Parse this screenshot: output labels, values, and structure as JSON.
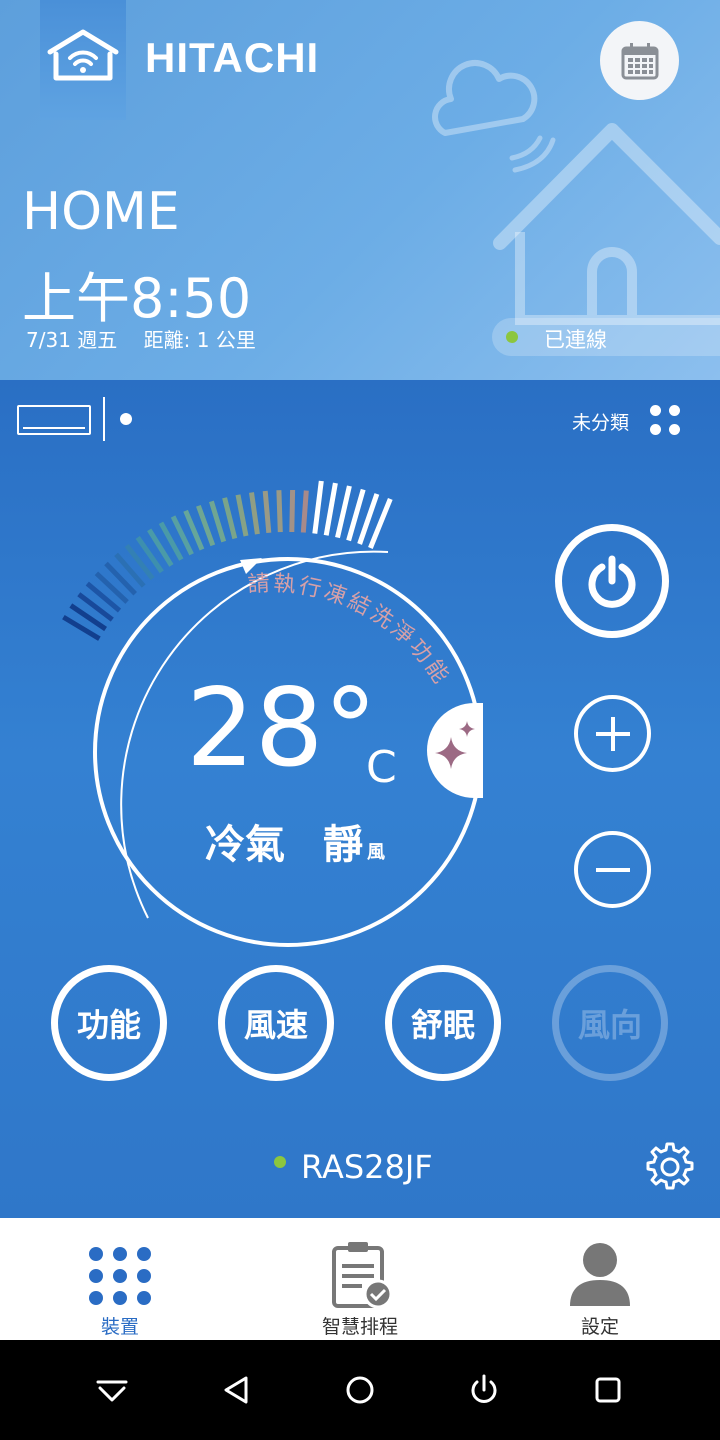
{
  "header": {
    "brand": "HITACHI",
    "location": "HOME",
    "time": "上午8:50",
    "date": "7/31 週五",
    "distance": "距離: 1 公里",
    "connection_status": "已連線",
    "status_color": "#8cc63f"
  },
  "device_bar": {
    "category": "未分類"
  },
  "dial": {
    "notice": "請執行凍結洗淨功能",
    "temperature": "28°",
    "unit": "C",
    "mode": "冷氣",
    "fan": "靜",
    "fan_suffix": "風"
  },
  "controls": {
    "buttons": [
      {
        "label": "功能",
        "enabled": true
      },
      {
        "label": "風速",
        "enabled": true
      },
      {
        "label": "舒眠",
        "enabled": true
      },
      {
        "label": "風向",
        "enabled": false
      }
    ]
  },
  "device": {
    "model": "RAS28JF"
  },
  "tabs": [
    {
      "label": "裝置",
      "icon": "device-grid-icon",
      "active": true
    },
    {
      "label": "智慧排程",
      "icon": "schedule-clipboard-icon",
      "active": false
    },
    {
      "label": "設定",
      "icon": "user-icon",
      "active": false
    }
  ],
  "colors": {
    "accent": "#2a6cc4",
    "header_bg": "#6cade6",
    "main_bg": "#3481d2",
    "connected": "#8cc63f"
  }
}
